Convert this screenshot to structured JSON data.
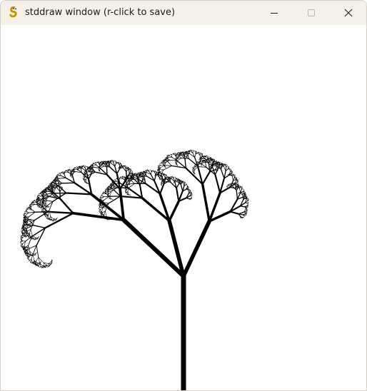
{
  "window": {
    "title": "stddraw window (r-click to save)",
    "icon": "pygame-snake-icon",
    "buttons": {
      "minimize": "minimize-icon",
      "maximize": "maximize-icon",
      "close": "close-icon"
    }
  },
  "canvas": {
    "background": "#ffffff",
    "drawing": "fractal-tree",
    "stroke_color": "#000000"
  }
}
